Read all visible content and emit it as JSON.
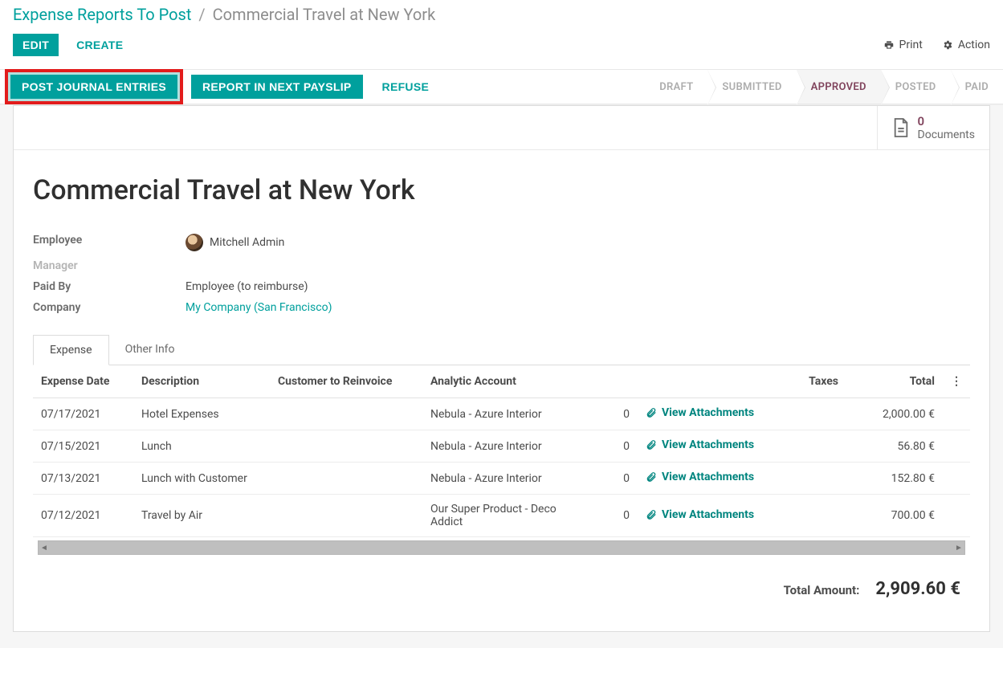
{
  "breadcrumb": {
    "parent": "Expense Reports To Post",
    "current": "Commercial Travel at New York"
  },
  "toolbar": {
    "edit": "EDIT",
    "create": "CREATE",
    "print": "Print",
    "action": "Action"
  },
  "statusbar": {
    "post_journal": "POST JOURNAL ENTRIES",
    "report_payslip": "REPORT IN NEXT PAYSLIP",
    "refuse": "REFUSE",
    "steps": [
      "DRAFT",
      "SUBMITTED",
      "APPROVED",
      "POSTED",
      "PAID"
    ],
    "active_step": "APPROVED"
  },
  "documents": {
    "count": "0",
    "label": "Documents"
  },
  "record": {
    "title": "Commercial Travel at New York",
    "fields": {
      "employee_label": "Employee",
      "employee_value": "Mitchell Admin",
      "manager_label": "Manager",
      "manager_value": "",
      "paidby_label": "Paid By",
      "paidby_value": "Employee (to reimburse)",
      "company_label": "Company",
      "company_value": "My Company (San Francisco)"
    }
  },
  "tabs": {
    "expense": "Expense",
    "other": "Other Info"
  },
  "table": {
    "headers": {
      "date": "Expense Date",
      "desc": "Description",
      "customer": "Customer to Reinvoice",
      "analytic": "Analytic Account",
      "taxes": "Taxes",
      "total": "Total"
    },
    "attach_label": "View Attachments",
    "rows": [
      {
        "date": "07/17/2021",
        "desc": "Hotel Expenses",
        "customer": "",
        "analytic": "Nebula - Azure Interior",
        "taxes": "0",
        "total": "2,000.00 €"
      },
      {
        "date": "07/15/2021",
        "desc": "Lunch",
        "customer": "",
        "analytic": "Nebula - Azure Interior",
        "taxes": "0",
        "total": "56.80 €"
      },
      {
        "date": "07/13/2021",
        "desc": "Lunch with Customer",
        "customer": "",
        "analytic": "Nebula - Azure Interior",
        "taxes": "0",
        "total": "152.80 €"
      },
      {
        "date": "07/12/2021",
        "desc": "Travel by Air",
        "customer": "",
        "analytic": "Our Super Product - Deco Addict",
        "taxes": "0",
        "total": "700.00 €"
      }
    ]
  },
  "total": {
    "label": "Total Amount:",
    "value": "2,909.60 €"
  }
}
